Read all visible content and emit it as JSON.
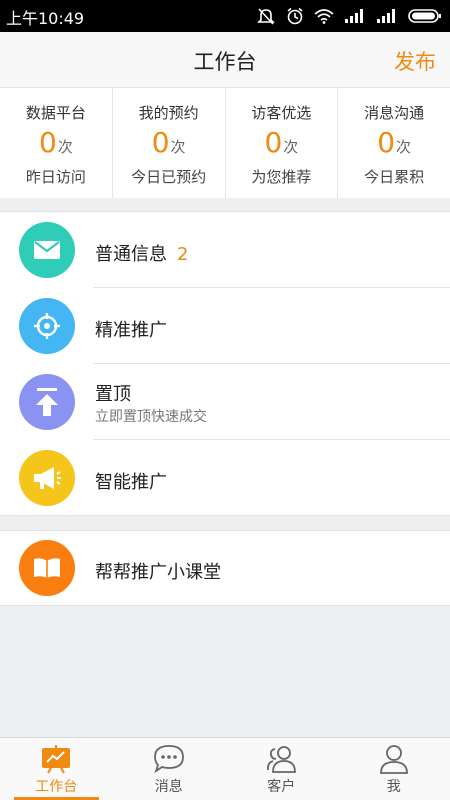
{
  "status_bar": {
    "time": "上午10:49"
  },
  "header": {
    "title": "工作台",
    "publish_label": "发布"
  },
  "stats": [
    {
      "label": "数据平台",
      "count": "0",
      "unit": "次",
      "sub": "昨日访问"
    },
    {
      "label": "我的预约",
      "count": "0",
      "unit": "次",
      "sub": "今日已预约"
    },
    {
      "label": "访客优选",
      "count": "0",
      "unit": "次",
      "sub": "为您推荐"
    },
    {
      "label": "消息沟通",
      "count": "0",
      "unit": "次",
      "sub": "今日累积"
    }
  ],
  "menu": [
    {
      "label": "普通信息",
      "badge": "2",
      "icon": "mail-icon",
      "color": "#2fcdb7"
    },
    {
      "label": "精准推广",
      "icon": "target-icon",
      "color": "#43b6f3"
    },
    {
      "label": "置顶",
      "desc": "立即置顶快速成交",
      "icon": "arrow-up-icon",
      "color": "#8b93f2"
    },
    {
      "label": "智能推广",
      "icon": "megaphone-icon",
      "color": "#f5c51b"
    }
  ],
  "course": {
    "label": "帮帮推广小课堂",
    "icon": "book-icon",
    "color": "#fa7d0f"
  },
  "tabbar": [
    {
      "label": "工作台",
      "icon": "workbench-icon",
      "active": true
    },
    {
      "label": "消息",
      "icon": "chat-icon"
    },
    {
      "label": "客户",
      "icon": "customers-icon"
    },
    {
      "label": "我",
      "icon": "profile-icon"
    }
  ],
  "colors": {
    "accent": "#f08a10"
  }
}
